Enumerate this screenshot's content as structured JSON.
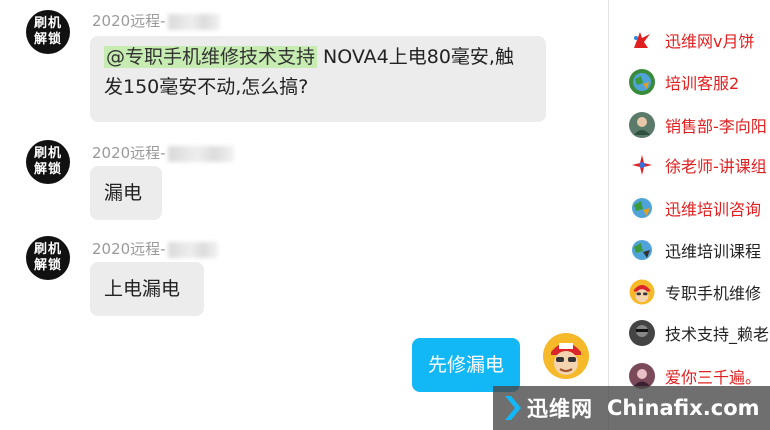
{
  "chat": {
    "messages": [
      {
        "avatar_lines": [
          "刷机",
          "解锁"
        ],
        "sender": "2020远程-",
        "mention": "@专职手机维修技术支持",
        "text_line1": " NOVA4上电80毫安,触",
        "text_line2": "发150毫安不动,怎么搞?"
      },
      {
        "avatar_lines": [
          "刷机",
          "解锁"
        ],
        "sender": "2020远程-",
        "text": "漏电"
      },
      {
        "avatar_lines": [
          "刷机",
          "解锁"
        ],
        "sender": "2020远程-",
        "text": "上电漏电"
      }
    ],
    "my_message": {
      "text": "先修漏电"
    }
  },
  "members": [
    {
      "name": "迅维网v月饼",
      "color": "#e02020",
      "icon": "flag-icon"
    },
    {
      "name": "培训客服2",
      "color": "#e02020",
      "icon": "globe-icon"
    },
    {
      "name": "销售部-李向阳",
      "color": "#e02020",
      "icon": "person-icon"
    },
    {
      "name": "徐老师-讲课组",
      "color": "#e02020",
      "icon": "spark-icon"
    },
    {
      "name": "迅维培训咨询",
      "color": "#e02020",
      "icon": "globe-icon"
    },
    {
      "name": "迅维培训课程",
      "color": "#222222",
      "icon": "globe-icon"
    },
    {
      "name": "专职手机维修",
      "color": "#222222",
      "icon": "cartoon-icon"
    },
    {
      "name": "技术支持_赖老",
      "color": "#222222",
      "icon": "person-icon"
    },
    {
      "name": "爱你三千遍。",
      "color": "#e02020",
      "icon": "person-icon"
    }
  ],
  "watermark": {
    "cn": "迅维网",
    "en": "Chinafix.com"
  }
}
